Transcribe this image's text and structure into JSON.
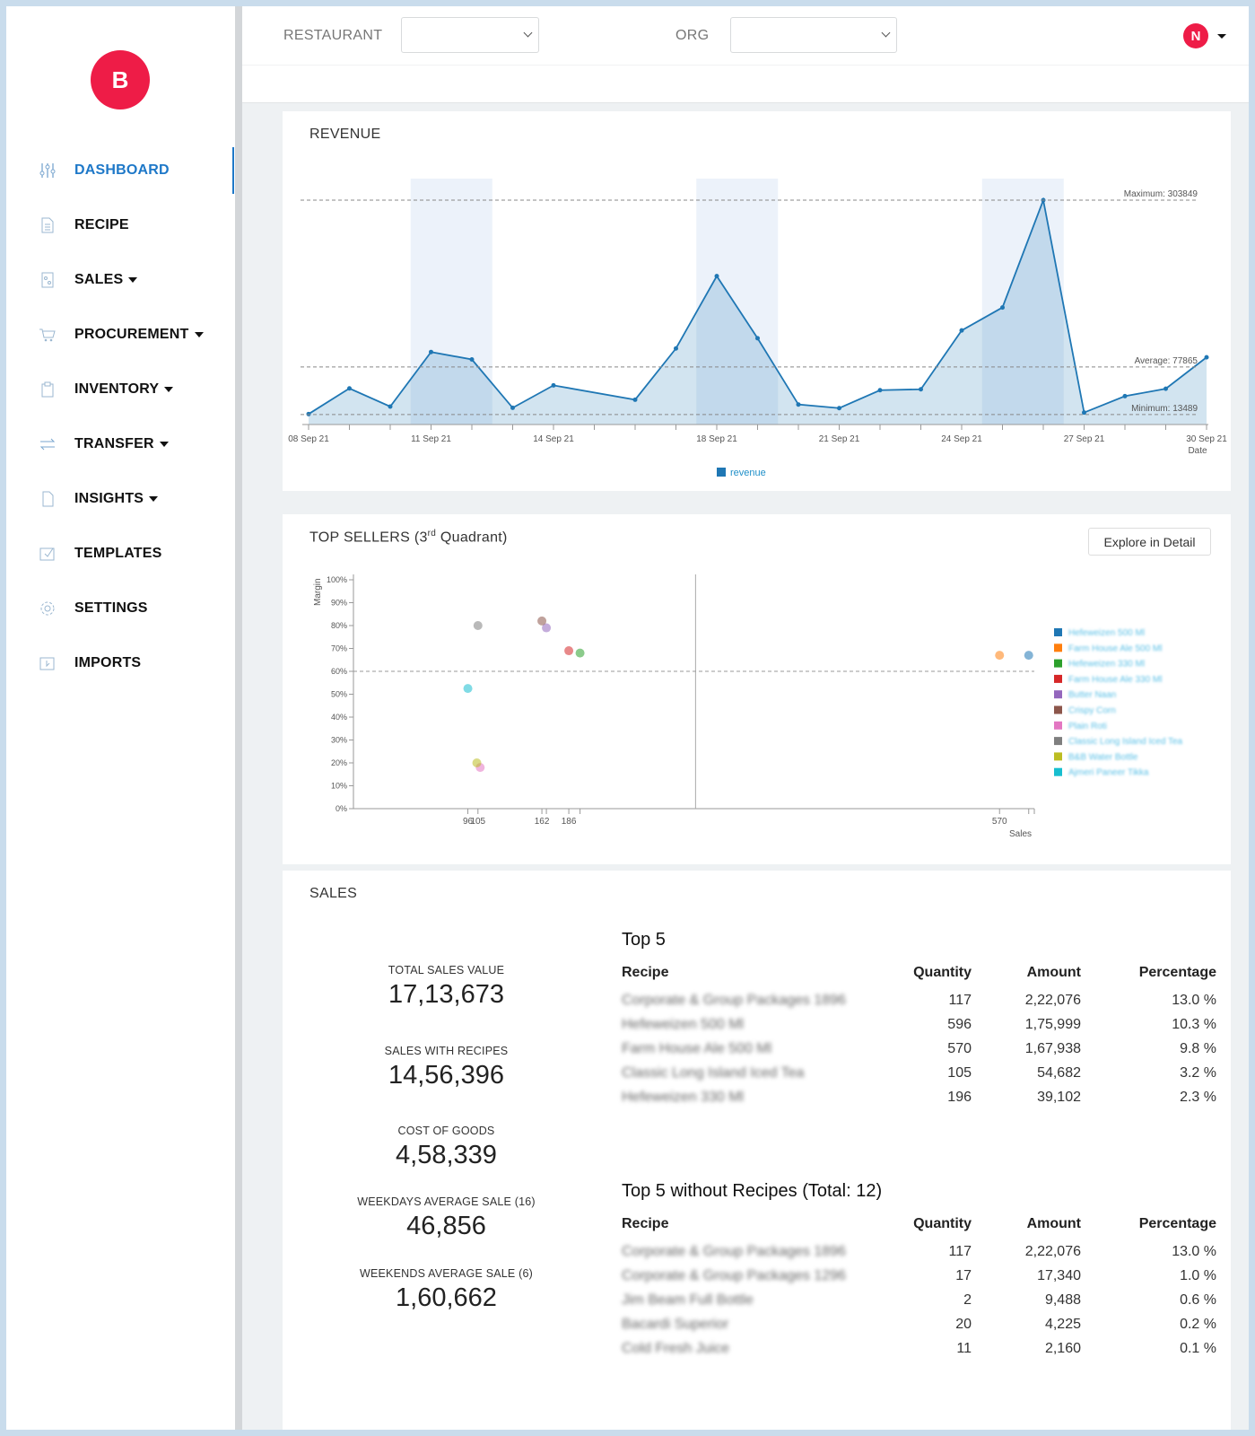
{
  "brand": {
    "logo_letter": "B",
    "accent": "#1e78c8",
    "brand_red": "#ee1c47"
  },
  "sidebar": {
    "items": [
      {
        "label": "DASHBOARD",
        "icon": "sliders-icon",
        "active": true,
        "dropdown": false
      },
      {
        "label": "RECIPE",
        "icon": "document-icon",
        "dropdown": false
      },
      {
        "label": "SALES",
        "icon": "receipt-icon",
        "dropdown": true
      },
      {
        "label": "PROCUREMENT",
        "icon": "cart-icon",
        "dropdown": true
      },
      {
        "label": "INVENTORY",
        "icon": "clipboard-icon",
        "dropdown": true
      },
      {
        "label": "TRANSFER",
        "icon": "transfer-arrows-icon",
        "dropdown": true
      },
      {
        "label": "INSIGHTS",
        "icon": "file-icon",
        "dropdown": true
      },
      {
        "label": "TEMPLATES",
        "icon": "template-icon",
        "dropdown": false
      },
      {
        "label": "SETTINGS",
        "icon": "gear-icon",
        "dropdown": false
      },
      {
        "label": "IMPORTS",
        "icon": "import-icon",
        "dropdown": false
      }
    ]
  },
  "header": {
    "restaurant_label": "RESTAURANT",
    "restaurant_value": "",
    "org_label": "ORG",
    "org_value": "",
    "user_initial": "N"
  },
  "revenue": {
    "title": "REVENUE",
    "legend": "revenue",
    "max_label": "Maximum: 303849",
    "avg_label": "Average: 77865",
    "min_label": "Minimum: 13489",
    "x_axis_label": "Date"
  },
  "top_sellers": {
    "title_prefix": "TOP SELLERS (3",
    "title_sup": "rd",
    "title_suffix": " Quadrant)",
    "explore_button": "Explore in Detail",
    "x_axis_label": "Sales",
    "y_axis_label": "Margin"
  },
  "sales": {
    "title": "SALES",
    "kpis": [
      {
        "label": "TOTAL SALES VALUE",
        "value": "17,13,673"
      },
      {
        "label": "SALES WITH RECIPES",
        "value": "14,56,396"
      },
      {
        "label": "COST OF GOODS",
        "value": "4,58,339"
      },
      {
        "label": "WEEKDAYS AVERAGE SALE (16)",
        "value": "46,856"
      },
      {
        "label": "WEEKENDS AVERAGE SALE (6)",
        "value": "1,60,662"
      }
    ],
    "top5": {
      "title": "Top 5",
      "columns": [
        "Recipe",
        "Quantity",
        "Amount",
        "Percentage"
      ],
      "rows": [
        [
          "Corporate & Group Packages 1896",
          "117",
          "2,22,076",
          "13.0 %"
        ],
        [
          "Hefeweizen 500 Ml",
          "596",
          "1,75,999",
          "10.3 %"
        ],
        [
          "Farm House Ale 500 Ml",
          "570",
          "1,67,938",
          "9.8 %"
        ],
        [
          "Classic Long Island Iced Tea",
          "105",
          "54,682",
          "3.2 %"
        ],
        [
          "Hefeweizen 330 Ml",
          "196",
          "39,102",
          "2.3 %"
        ]
      ]
    },
    "top5_no_recipe": {
      "title": "Top 5 without Recipes (Total: 12)",
      "columns": [
        "Recipe",
        "Quantity",
        "Amount",
        "Percentage"
      ],
      "rows": [
        [
          "Corporate & Group Packages 1896",
          "117",
          "2,22,076",
          "13.0 %"
        ],
        [
          "Corporate & Group Packages 1296",
          "17",
          "17,340",
          "1.0 %"
        ],
        [
          "Jim Beam Full Bottle",
          "2",
          "9,488",
          "0.6 %"
        ],
        [
          "Bacardi Superior",
          "20",
          "4,225",
          "0.2 %"
        ],
        [
          "Cold Fresh Juice",
          "11",
          "2,160",
          "0.1 %"
        ]
      ]
    }
  },
  "chart_data": [
    {
      "type": "area",
      "name": "revenue",
      "x_label": "Date",
      "x": [
        "08 Sep 21",
        "09 Sep 21",
        "10 Sep 21",
        "11 Sep 21",
        "12 Sep 21",
        "13 Sep 21",
        "14 Sep 21",
        "16 Sep 21",
        "17 Sep 21",
        "18 Sep 21",
        "19 Sep 21",
        "20 Sep 21",
        "21 Sep 21",
        "22 Sep 21",
        "23 Sep 21",
        "24 Sep 21",
        "25 Sep 21",
        "26 Sep 21",
        "27 Sep 21",
        "28 Sep 21",
        "29 Sep 21",
        "30 Sep 21"
      ],
      "day": [
        8,
        9,
        10,
        11,
        12,
        13,
        14,
        16,
        17,
        18,
        19,
        20,
        21,
        22,
        23,
        24,
        25,
        26,
        27,
        28,
        29,
        30
      ],
      "values": [
        14200,
        48900,
        24300,
        98200,
        88100,
        22600,
        53000,
        33600,
        103000,
        201000,
        116800,
        27100,
        22200,
        46500,
        47700,
        127400,
        158500,
        303849,
        16200,
        38400,
        48500,
        91000
      ],
      "tick_labels": [
        {
          "day": 8,
          "label": "08 Sep 21"
        },
        {
          "day": 11,
          "label": "11 Sep 21"
        },
        {
          "day": 14,
          "label": "14 Sep 21"
        },
        {
          "day": 18,
          "label": "18 Sep 21"
        },
        {
          "day": 21,
          "label": "21 Sep 21"
        },
        {
          "day": 24,
          "label": "24 Sep 21"
        },
        {
          "day": 27,
          "label": "27 Sep 21"
        },
        {
          "day": 30,
          "label": "30 Sep 21"
        }
      ],
      "reference_lines": {
        "maximum": 303849,
        "average": 77865,
        "minimum": 13489
      },
      "weekend_bands": [
        [
          11,
          12
        ],
        [
          18,
          19
        ],
        [
          25,
          26
        ]
      ],
      "ylim": [
        0,
        303849
      ],
      "color": "#1f77b4",
      "legend": "bottom-center"
    },
    {
      "type": "scatter",
      "x_label": "Sales",
      "y_label": "Margin",
      "xlim": [
        -6,
        601
      ],
      "ylim": [
        0,
        100
      ],
      "y_ticks": [
        0,
        10,
        20,
        30,
        40,
        50,
        60,
        70,
        80,
        90,
        100
      ],
      "x_ticks": [
        96,
        105,
        162,
        186,
        570
      ],
      "x_minor_ticks": [
        96,
        105,
        162,
        166,
        186,
        196,
        570,
        596,
        601
      ],
      "x_split": 299,
      "y_split": 60,
      "legend": "right",
      "series": [
        {
          "name": "Hefeweizen 500 Ml",
          "color": "#1f77b4",
          "x": 596,
          "y": 67
        },
        {
          "name": "Farm House Ale 500 Ml",
          "color": "#ff7f0e",
          "x": 570,
          "y": 67
        },
        {
          "name": "Hefeweizen 330 Ml",
          "color": "#2ca02c",
          "x": 196,
          "y": 68
        },
        {
          "name": "Farm House Ale 330 Ml",
          "color": "#d62728",
          "x": 186,
          "y": 69
        },
        {
          "name": "Butter Naan",
          "color": "#9467bd",
          "x": 166,
          "y": 79
        },
        {
          "name": "Crispy Corn",
          "color": "#8c564b",
          "x": 162,
          "y": 82
        },
        {
          "name": "Plain Roti",
          "color": "#e377c2",
          "x": 107,
          "y": 18
        },
        {
          "name": "Classic Long Island Iced Tea",
          "color": "#7f7f7f",
          "x": 105,
          "y": 80
        },
        {
          "name": "B&B Water Bottle",
          "color": "#bcbd22",
          "x": 104,
          "y": 20
        },
        {
          "name": "Ajmeri Paneer Tikka",
          "color": "#17becf",
          "x": 96,
          "y": 52.5
        }
      ]
    }
  ]
}
